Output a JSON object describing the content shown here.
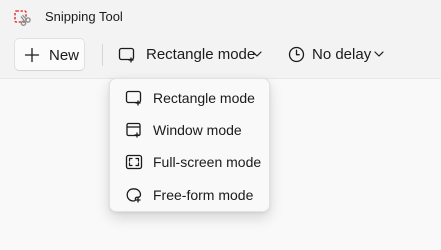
{
  "app": {
    "title": "Snipping Tool",
    "icon": "snipping-tool-icon",
    "accent_color": "#e0433b"
  },
  "toolbar": {
    "new_label": "New",
    "new_icon": "plus-icon",
    "mode_label": "Rectangle mode",
    "mode_icon": "rectangle-mode-icon",
    "delay_label": "No delay",
    "delay_icon": "clock-icon"
  },
  "mode_menu": {
    "items": [
      {
        "label": "Rectangle mode",
        "icon": "rectangle-mode-icon"
      },
      {
        "label": "Window mode",
        "icon": "window-mode-icon"
      },
      {
        "label": "Full-screen mode",
        "icon": "full-screen-mode-icon"
      },
      {
        "label": "Free-form mode",
        "icon": "free-form-mode-icon"
      }
    ]
  }
}
